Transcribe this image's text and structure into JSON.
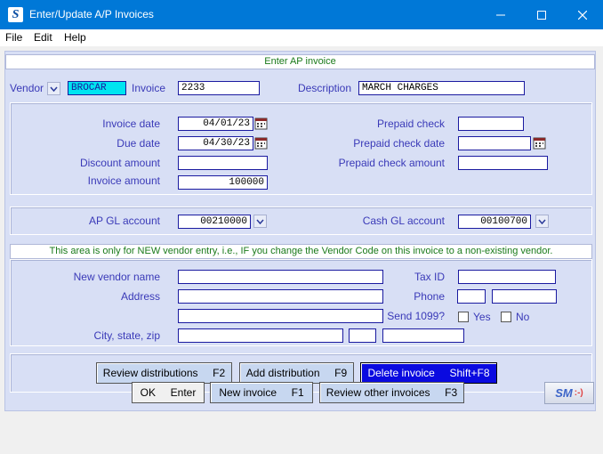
{
  "window": {
    "title": "Enter/Update A/P Invoices",
    "app_icon": "S"
  },
  "menu": [
    "File",
    "Edit",
    "Help"
  ],
  "header": "Enter AP invoice",
  "vendor": {
    "vendor_label": "Vendor",
    "vendor_value": "BROCAR",
    "invoice_label": "Invoice",
    "invoice_value": "2233",
    "description_label": "Description",
    "description_value": "MARCH CHARGES"
  },
  "dates": {
    "invoice_date_label": "Invoice date",
    "invoice_date_value": "04/01/23",
    "due_date_label": "Due date",
    "due_date_value": "04/30/23",
    "discount_amount_label": "Discount amount",
    "discount_amount_value": "",
    "invoice_amount_label": "Invoice amount",
    "invoice_amount_value": "100000",
    "prepaid_check_label": "Prepaid check",
    "prepaid_check_value": "",
    "prepaid_check_date_label": "Prepaid check date",
    "prepaid_check_date_value": "",
    "prepaid_check_amount_label": "Prepaid check amount",
    "prepaid_check_amount_value": ""
  },
  "gl": {
    "ap_gl_label": "AP GL account",
    "ap_gl_value": "00210000",
    "cash_gl_label": "Cash GL account",
    "cash_gl_value": "00100700"
  },
  "new_vendor": {
    "note": "This area is only for NEW vendor entry, i.e., IF you change the Vendor Code on this invoice to a non-existing vendor.",
    "name_label": "New vendor name",
    "address_label": "Address",
    "city_label": "City, state, zip",
    "tax_id_label": "Tax ID",
    "phone_label": "Phone",
    "send1099_label": "Send 1099?",
    "yes_label": "Yes",
    "no_label": "No"
  },
  "actions": {
    "review_distributions": "Review distributions     F2",
    "add_distribution": "Add distribution     F9",
    "delete_invoice": "Delete invoice     Shift+F8"
  },
  "footer": {
    "ok": "OK     Enter",
    "new_invoice": "New invoice     F1",
    "review_other": "Review other invoices     F3",
    "logo_text": "SM",
    "logo_smile": ":-)"
  },
  "colors": {
    "titlebar": "#0078d7",
    "form_bg": "#d8dff5",
    "label": "#3a3ab8",
    "note": "#1a7a1a",
    "vendor_field": "#00e5f0",
    "delete_button": "#0a0ae0"
  }
}
